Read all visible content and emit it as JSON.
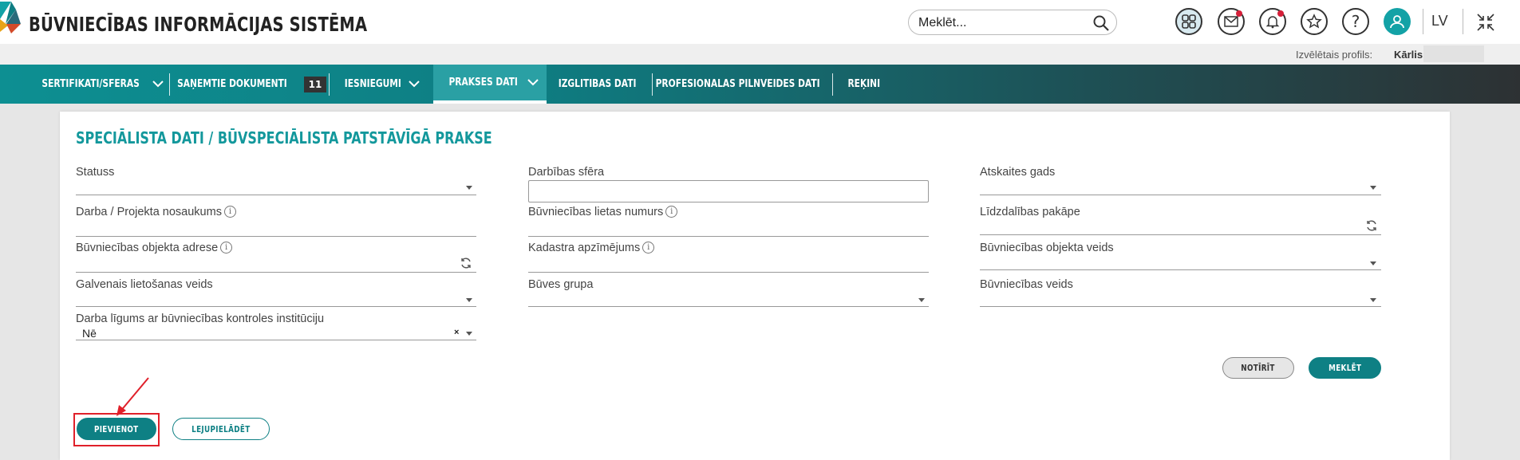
{
  "header": {
    "title": "BŪVNIECĪBAS INFORMĀCIJAS SISTĒMA",
    "search_placeholder": "Meklēt...",
    "language": "LV",
    "icons": [
      "apps-icon",
      "mail-icon",
      "bell-icon",
      "star-icon",
      "help-icon",
      "user-icon",
      "collapse-icon"
    ]
  },
  "profile": {
    "label": "Izvēlētais profils:",
    "name": "Kārlis"
  },
  "nav": {
    "items": [
      {
        "label": "SERTIFIKĀTI/SFĒRAS",
        "dropdown": true
      },
      {
        "label": "SAŅEMTIE DOKUMENTI",
        "badge": "11"
      },
      {
        "label": "IESNIEGUMI",
        "dropdown": true
      },
      {
        "label": "PRAKSES DATI",
        "dropdown": true,
        "active": true
      },
      {
        "label": "IZGLĪTĪBAS DATI"
      },
      {
        "label": "PROFESIONĀLĀS PILNVEIDES DATI"
      },
      {
        "label": "RĒĶINI"
      }
    ]
  },
  "page": {
    "title": "SPECIĀLISTA DATI / BŪVSPECIĀLISTA PATSTĀVĪGĀ PRAKSE"
  },
  "filters": {
    "statuss": {
      "label": "Statuss",
      "value": ""
    },
    "darba_nosaukums": {
      "label": "Darba / Projekta nosaukums",
      "value": ""
    },
    "objekta_adrese": {
      "label": "Būvniecības objekta adrese",
      "value": ""
    },
    "lietosanas_veids": {
      "label": "Galvenais lietošanas veids",
      "value": ""
    },
    "darba_ligums": {
      "label": "Darba līgums ar būvniecības kontroles institūciju",
      "value": "Nē",
      "clear": "×"
    },
    "darbibas_sfera": {
      "label": "Darbības sfēra",
      "value": ""
    },
    "lietas_numurs": {
      "label": "Būvniecības lietas numurs",
      "value": ""
    },
    "kadastra_apz": {
      "label": "Kadastra apzīmējums",
      "value": ""
    },
    "buves_grupa": {
      "label": "Būves grupa",
      "value": ""
    },
    "atskaites_gads": {
      "label": "Atskaites gads",
      "value": ""
    },
    "lidzdalibas_pakape": {
      "label": "Līdzdalības pakāpe",
      "value": ""
    },
    "objekta_veids": {
      "label": "Būvniecības objekta veids",
      "value": ""
    },
    "buvniecibas_veids": {
      "label": "Būvniecības veids",
      "value": ""
    }
  },
  "buttons": {
    "clear": "NOTĪRĪT",
    "search": "MEKLĒT",
    "add": "PIEVIENOT",
    "download": "LEJUPIELĀDĒT"
  },
  "colors": {
    "accent": "#0e8084",
    "title": "#13989c",
    "highlight": "#e0202a"
  }
}
